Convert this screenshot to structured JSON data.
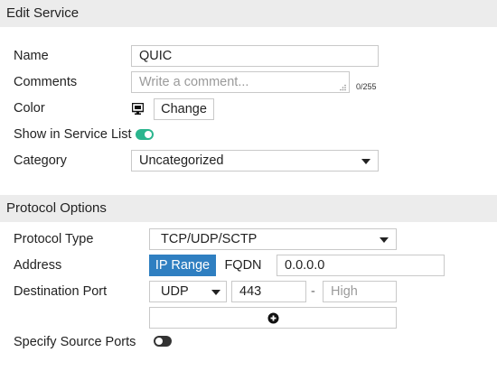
{
  "edit_service": {
    "title": "Edit Service",
    "name_label": "Name",
    "name_value": "QUIC",
    "comments_label": "Comments",
    "comments_placeholder": "Write a comment...",
    "comments_counter": "0/255",
    "color_label": "Color",
    "color_icon": "monitor-icon",
    "change_label": "Change",
    "show_in_list_label": "Show in Service List",
    "show_in_list_enabled": true,
    "category_label": "Category",
    "category_value": "Uncategorized"
  },
  "protocol_options": {
    "title": "Protocol Options",
    "protocol_type_label": "Protocol Type",
    "protocol_type_value": "TCP/UDP/SCTP",
    "address_label": "Address",
    "ip_range_label": "IP Range",
    "fqdn_label": "FQDN",
    "address_value": "0.0.0.0",
    "destination_port_label": "Destination Port",
    "port_protocol": "UDP",
    "port_low": "443",
    "port_separator": "-",
    "port_high_placeholder": "High",
    "add_icon": "plus-circle-icon",
    "specify_source_ports_label": "Specify Source Ports",
    "specify_source_ports_enabled": false
  },
  "colors": {
    "accent": "#2f7fc1",
    "toggle_on": "#2bb58e",
    "toggle_off": "#333333",
    "header_bg": "#ececec"
  }
}
